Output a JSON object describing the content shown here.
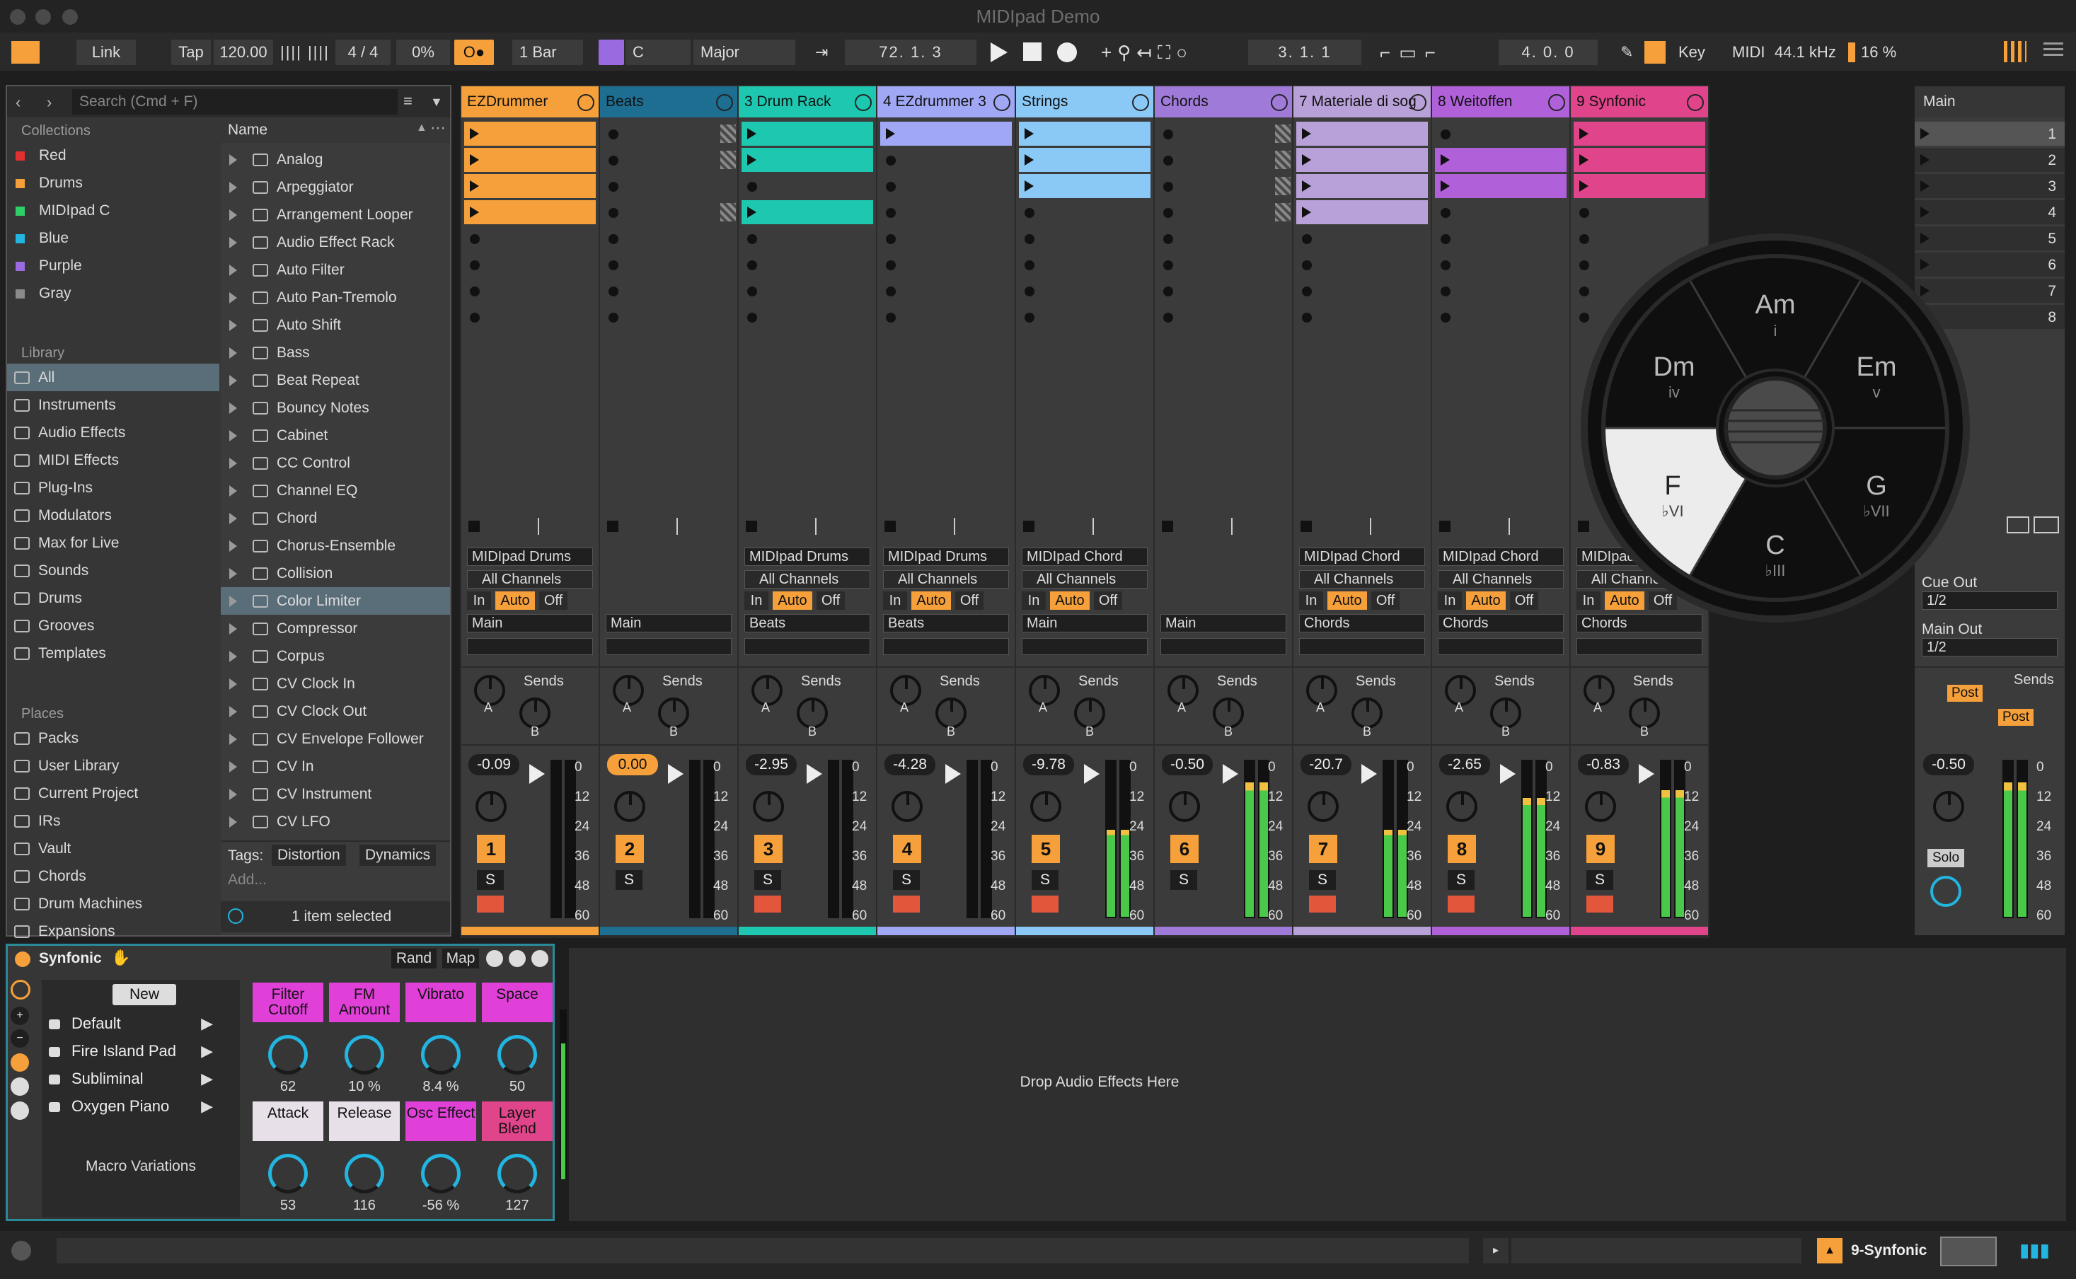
{
  "window": {
    "title": "MIDIpad Demo"
  },
  "transport": {
    "link": "Link",
    "tap": "Tap",
    "tempo": "120.00",
    "signature": "4 / 4",
    "groove": "0%",
    "quantize": "1 Bar",
    "key_root": "C",
    "key_scale": "Major",
    "arr_position": "72.  1.  3",
    "loop_start": "3.  1.  1",
    "loop_length": "4.  0.  0",
    "key_label": "Key",
    "midi_label": "MIDI",
    "sample_rate": "44.1 kHz",
    "cpu": "16 %"
  },
  "browser": {
    "search_placeholder": "Search (Cmd + F)",
    "collections_title": "Collections",
    "collections": [
      {
        "label": "Red",
        "color": "#e03030"
      },
      {
        "label": "Drums",
        "color": "#f5a03a"
      },
      {
        "label": "MIDIpad C",
        "color": "#2fcf6a"
      },
      {
        "label": "Blue",
        "color": "#22b5e0"
      },
      {
        "label": "Purple",
        "color": "#9a6ae0"
      },
      {
        "label": "Gray",
        "color": "#8a8a8a"
      }
    ],
    "library_title": "Library",
    "library": [
      "All",
      "Instruments",
      "Audio Effects",
      "MIDI Effects",
      "Plug-Ins",
      "Modulators",
      "Max for Live",
      "Sounds",
      "Drums",
      "Grooves",
      "Templates"
    ],
    "places_title": "Places",
    "places": [
      "Packs",
      "User Library",
      "Current Project",
      "IRs",
      "Vault",
      "Chords",
      "Drum Machines",
      "Expansions"
    ],
    "name_header": "Name",
    "items": [
      "Analog",
      "Arpeggiator",
      "Arrangement Looper",
      "Audio Effect Rack",
      "Auto Filter",
      "Auto Pan-Tremolo",
      "Auto Shift",
      "Bass",
      "Beat Repeat",
      "Bouncy Notes",
      "Cabinet",
      "CC Control",
      "Channel EQ",
      "Chord",
      "Chorus-Ensemble",
      "Collision",
      "Color Limiter",
      "Compressor",
      "Corpus",
      "CV Clock In",
      "CV Clock Out",
      "CV Envelope Follower",
      "CV In",
      "CV Instrument",
      "CV LFO"
    ],
    "tags_label": "Tags:",
    "tags": [
      "Distortion",
      "Dynamics"
    ],
    "add_label": "Add...",
    "status": "1 item selected"
  },
  "tracks": [
    {
      "name": "EZDrummer",
      "color": "#f5a03a",
      "input": "MIDIpad Drums",
      "channel": "All Channels",
      "output": "Main",
      "volume": "-0.09",
      "number": "1",
      "meter": 0
    },
    {
      "name": "Beats",
      "color": "#1e6e92",
      "input": "",
      "channel": "",
      "output": "Main",
      "volume": "0.00",
      "number": "2",
      "meter": 0
    },
    {
      "name": "3 Drum Rack",
      "color": "#1ec8b0",
      "input": "MIDIpad Drums",
      "channel": "All Channels",
      "output": "Beats",
      "volume": "-2.95",
      "number": "3",
      "meter": 0
    },
    {
      "name": "4 EZdrummer 3",
      "color": "#a0a8f5",
      "input": "MIDIpad Drums",
      "channel": "All Channels",
      "output": "Beats",
      "volume": "-4.28",
      "number": "4",
      "meter": 0
    },
    {
      "name": "Strings",
      "color": "#8ac8f5",
      "input": "MIDIpad Chord",
      "channel": "All Channels",
      "output": "Main",
      "volume": "-9.78",
      "number": "5",
      "meter": 0.55
    },
    {
      "name": "Chords",
      "color": "#a07ad8",
      "input": "",
      "channel": "",
      "output": "Main",
      "volume": "-0.50",
      "number": "6",
      "meter": 0.85
    },
    {
      "name": "7 Materiale di sog",
      "color": "#b8a0d8",
      "input": "MIDIpad Chord",
      "channel": "All Channels",
      "output": "Chords",
      "volume": "-20.7",
      "number": "7",
      "meter": 0.55
    },
    {
      "name": "8 Weitoffen",
      "color": "#b060d8",
      "input": "MIDIpad Chord",
      "channel": "All Channels",
      "output": "Chords",
      "volume": "-2.65",
      "number": "8",
      "meter": 0.75
    },
    {
      "name": "9 Synfonic",
      "color": "#e0448a",
      "input": "MIDIpad Chord",
      "channel": "All Channels",
      "output": "Chords",
      "volume": "-0.83",
      "number": "9",
      "meter": 0.8
    }
  ],
  "mixer_labels": {
    "in": "In",
    "auto": "Auto",
    "off": "Off",
    "sends": "Sends",
    "a": "A",
    "b": "B",
    "s": "S",
    "scale": [
      "0",
      "12",
      "24",
      "36",
      "48",
      "60"
    ]
  },
  "main": {
    "name": "Main",
    "scenes": [
      "1",
      "2",
      "3",
      "4",
      "5",
      "6",
      "7",
      "8"
    ],
    "cue_out_label": "Cue Out",
    "cue_out": "1/2",
    "main_out_label": "Main Out",
    "main_out": "1/2",
    "post": "Post",
    "volume": "-0.50",
    "solo": "Solo"
  },
  "chord_wheel": {
    "chords": [
      {
        "name": "Am",
        "degree": "i"
      },
      {
        "name": "Em",
        "degree": "v"
      },
      {
        "name": "G",
        "degree": "♭VII"
      },
      {
        "name": "C",
        "degree": "♭III"
      },
      {
        "name": "F",
        "degree": "♭VI"
      },
      {
        "name": "Dm",
        "degree": "iv"
      }
    ]
  },
  "device": {
    "name": "Synfonic",
    "rand": "Rand",
    "map": "Map",
    "new_label": "New",
    "presets": [
      "Default",
      "Fire Island Pad",
      "Subliminal",
      "Oxygen Piano"
    ],
    "macro_variations": "Macro Variations",
    "macros": [
      {
        "label": "Filter Cutoff",
        "value": "62",
        "color": "#e040d8"
      },
      {
        "label": "FM Amount",
        "value": "10 %",
        "color": "#e040d8"
      },
      {
        "label": "Vibrato",
        "value": "8.4 %",
        "color": "#e040d8"
      },
      {
        "label": "Space",
        "value": "50",
        "color": "#e040d8"
      },
      {
        "label": "Attack",
        "value": "53",
        "color": "#e8e0e8"
      },
      {
        "label": "Release",
        "value": "116",
        "color": "#e8e0e8"
      },
      {
        "label": "Osc Effect",
        "value": "-56 %",
        "color": "#e040d8"
      },
      {
        "label": "Layer Blend",
        "value": "127",
        "color": "#e0448a"
      }
    ]
  },
  "drop_zone": "Drop Audio Effects Here",
  "statusbar": {
    "track": "9-Synfonic"
  }
}
